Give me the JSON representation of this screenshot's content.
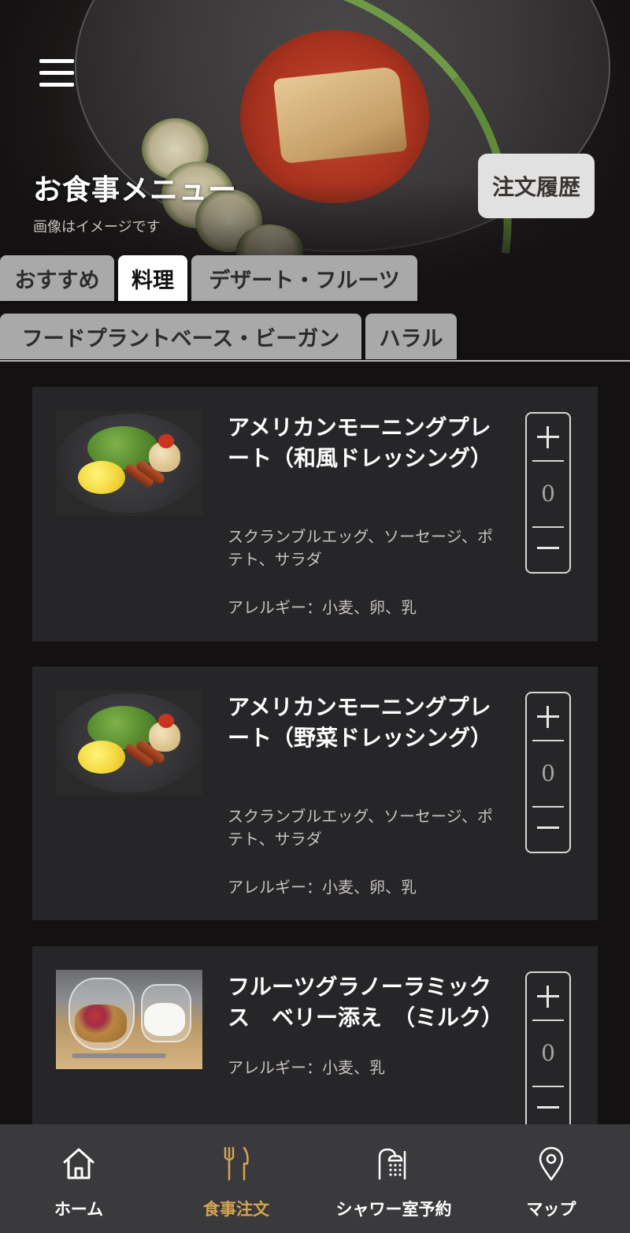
{
  "header": {
    "title": "お食事メニュー",
    "note": "画像はイメージです",
    "history_button": "注文履歴"
  },
  "tabs": [
    {
      "label": "おすすめ",
      "active": false
    },
    {
      "label": "料理",
      "active": true
    },
    {
      "label": "デザート・フルーツ",
      "active": false
    },
    {
      "label": "フードプラントベース・ビーガン",
      "active": false
    },
    {
      "label": "ハラル",
      "active": false
    }
  ],
  "menu_items": [
    {
      "name": "アメリカンモーニングプレート（和風ドレッシング）",
      "description": "スクランブルエッグ、ソーセージ、ポテト、サラダ",
      "allergy": "アレルギー：小麦、卵、乳",
      "quantity": "0"
    },
    {
      "name": "アメリカンモーニングプレート（野菜ドレッシング）",
      "description": "スクランブルエッグ、ソーセージ、ポテト、サラダ",
      "allergy": "アレルギー：小麦、卵、乳",
      "quantity": "0"
    },
    {
      "name": "フルーツグラノーラミックス　ベリー添え　（ミルク）",
      "description": "",
      "allergy": "アレルギー：小麦、乳",
      "quantity": "0"
    }
  ],
  "bottom_nav": [
    {
      "label": "ホーム",
      "icon": "home-icon",
      "active": false
    },
    {
      "label": "食事注文",
      "icon": "fork-knife-icon",
      "active": true
    },
    {
      "label": "シャワー室予約",
      "icon": "shower-icon",
      "active": false
    },
    {
      "label": "マップ",
      "icon": "map-pin-icon",
      "active": false
    }
  ],
  "colors": {
    "background": "#141112",
    "card": "#262528",
    "tab_inactive": "#a9a9a9",
    "tab_active": "#ffffff",
    "nav_bg": "#3a393c",
    "nav_active": "#d4a552"
  }
}
